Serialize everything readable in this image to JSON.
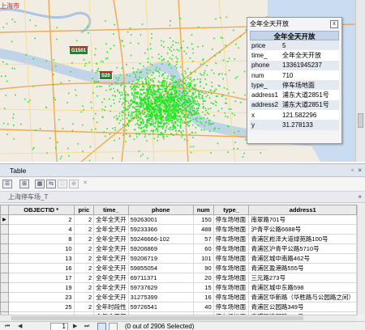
{
  "map": {
    "city_label": "上海市",
    "shield_1": "G1501",
    "shield_2": "S20",
    "point_color": "#22e622"
  },
  "popup": {
    "title": "全年全天开放",
    "header": "全年全天开放",
    "close_label": "x",
    "fields": [
      {
        "key": "price",
        "value": "5"
      },
      {
        "key": "time_",
        "value": "全年全天开放"
      },
      {
        "key": "phone",
        "value": "13361945237"
      },
      {
        "key": "num",
        "value": "710"
      },
      {
        "key": "type_",
        "value": "停车场地面"
      },
      {
        "key": "address1",
        "value": "浦东大道2851号"
      },
      {
        "key": "address2",
        "value": "浦东大道2851号"
      },
      {
        "key": "x",
        "value": "121.582296"
      },
      {
        "key": "y",
        "value": "31.278133"
      }
    ]
  },
  "table_window": {
    "title": "Table",
    "tab_label": "上海停车场_T",
    "columns": [
      "OBJECTID *",
      "pric",
      "time_",
      "phone",
      "num",
      "type_",
      "address1"
    ],
    "rows": [
      [
        "2",
        "2",
        "全年全天开",
        "59263001",
        "150",
        "停车场地面",
        "南翠路701号"
      ],
      [
        "4",
        "2",
        "全年全天开",
        "59233366",
        "488",
        "停车场地面",
        "沪青平公路6688号"
      ],
      [
        "8",
        "2",
        "全年全天开",
        "59246666-102",
        "57",
        "停车场地面",
        "青浦区崧泽大道绿苑路100号"
      ],
      [
        "10",
        "2",
        "全年全天开",
        "59206869",
        "60",
        "停车场地面",
        "青浦区沪青平公路5710号"
      ],
      [
        "13",
        "2",
        "全年全天开",
        "59206719",
        "101",
        "停车场地面",
        "青浦区城中南路462号"
      ],
      [
        "16",
        "2",
        "全年全天开",
        "59855054",
        "90",
        "停车场地面",
        "青浦区盈港路555号"
      ],
      [
        "17",
        "2",
        "全年全天开",
        "69711371",
        "20",
        "停车场地面",
        "三元路273号"
      ],
      [
        "19",
        "2",
        "全年全天开",
        "59737629",
        "15",
        "停车场地面",
        "青浦区城中东路598"
      ],
      [
        "23",
        "2",
        "全年全天开",
        "31275399",
        "16",
        "停车场地面",
        "青浦区华新路（华胜路与公园路之间）"
      ],
      [
        "25",
        "2",
        "全年时段性",
        "59726541",
        "40",
        "停车场地面",
        "青浦区公园路349号"
      ],
      [
        "26",
        "2",
        "全年全天开",
        "39222201",
        "121",
        "停车场地面",
        "青浦区清河路535号"
      ]
    ],
    "status": {
      "record": "1",
      "selection": "(0 out of 2906 Selected)"
    }
  }
}
